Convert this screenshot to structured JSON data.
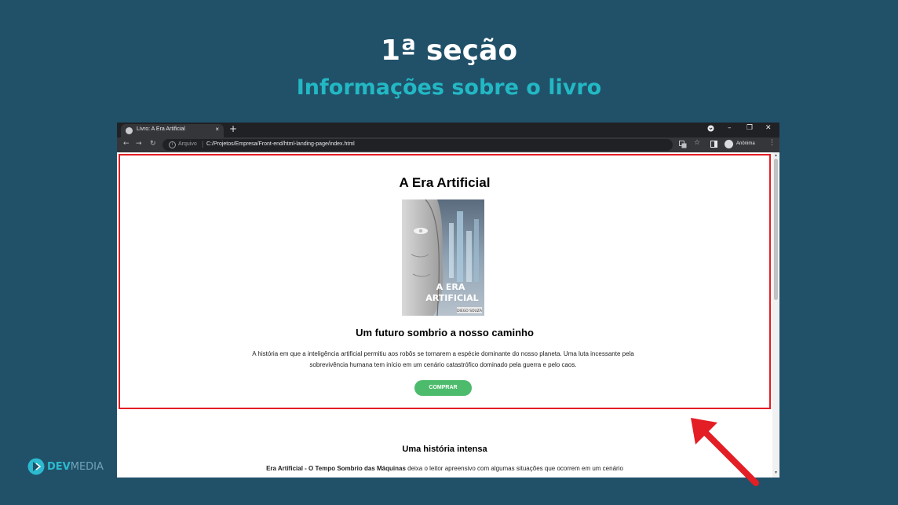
{
  "slide": {
    "title": "1ª seção",
    "subtitle": "Informações sobre o livro"
  },
  "browser": {
    "tab_title": "Livro: A Era Artificial",
    "tab_close": "×",
    "new_tab": "+",
    "window_controls": [
      "–",
      "❐",
      "✕"
    ],
    "address_protocol": "Arquivo",
    "address_url": "C:/Projetos/Empresa/Front-end/html-landing-page/index.html",
    "profile_name": "Anônima"
  },
  "page": {
    "book_title": "A Era Artificial",
    "cover": {
      "title_line1": "A ERA",
      "title_line2": "ARTIFICIAL",
      "author": "DIEGO SOUZA"
    },
    "tagline": "Um futuro sombrio a nosso caminho",
    "description": "A história em que a inteligência artificial permitiu aos robôs se tornarem a espécie dominante do nosso planeta. Uma luta incessante pela sobrevivência humana tem início em um cenário catastrófico dominado pela guerra e pelo caos.",
    "buy_button": "COMPRAR",
    "section2_title": "Uma história intensa",
    "section2_text_bold": "Era Artificial - O Tempo Sombrio das Máquinas",
    "section2_text_rest": " deixa o leitor apreensivo com algumas situações que ocorrem em um cenário"
  },
  "logo": {
    "dev": "DEV",
    "media": "MEDIA"
  },
  "colors": {
    "background": "#215169",
    "subtitle": "#22b8c4",
    "highlight_border": "#e31e24",
    "button": "#4dbb6c",
    "arrow": "#e31e24"
  }
}
